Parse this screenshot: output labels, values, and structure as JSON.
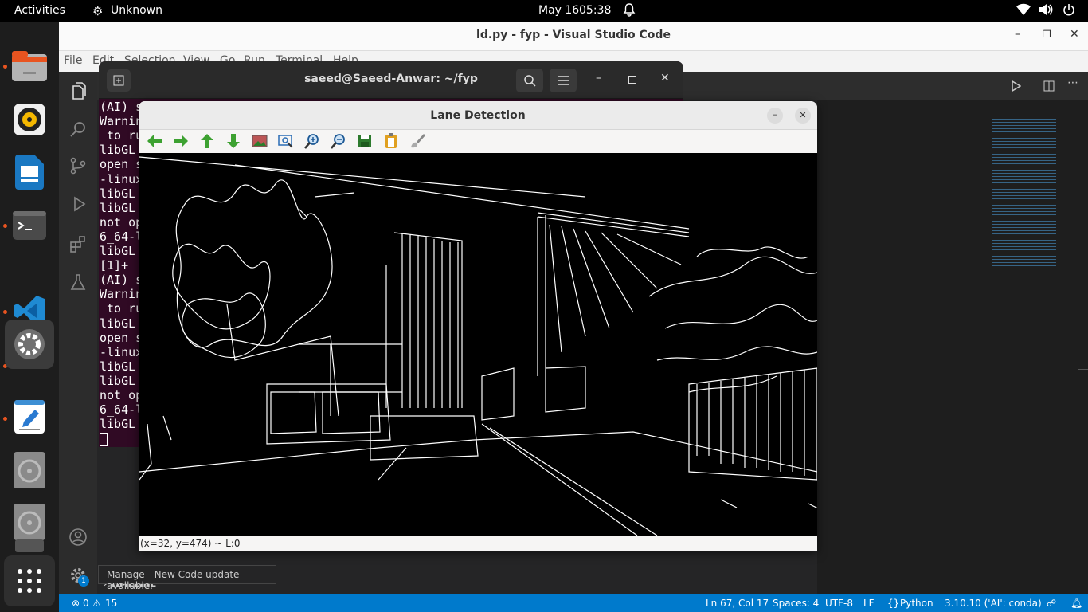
{
  "topbar": {
    "activities": "Activities",
    "app_name": "Unknown",
    "date": "May 16",
    "time": "05:38"
  },
  "vscode": {
    "title": "ld.py - fyp - Visual Studio Code",
    "menu": [
      "File",
      "Edit",
      "Selection",
      "View",
      "Go",
      "Run",
      "Terminal",
      "Help"
    ],
    "timeline": "TIMELINE",
    "tooltip": "Manage - New Code update available.",
    "manage_badge": "1",
    "status": {
      "errors": "0",
      "warnings": "15",
      "position": "Ln 67, Col 17",
      "spaces": "Spaces: 4",
      "encoding": "UTF-8",
      "eol": "LF",
      "language": "Python",
      "interpreter": "3.10.10 ('AI': conda)"
    }
  },
  "terminal": {
    "title": "saeed@Saeed-Anwar: ~/fyp",
    "lines": [
      "(AI) s",
      "Warnin",
      " to ru",
      "libGL ",
      "open s",
      "-linux",
      "libGL ",
      "libGL ",
      "not op",
      "6_64-l",
      "libGL ",
      "[1]+ ",
      "(AI) s",
      "Warnin",
      " to ru",
      "libGL ",
      "open s",
      "-linux",
      "libGL ",
      "libGL ",
      "not op",
      "6_64-l",
      "libGL "
    ]
  },
  "lane_window": {
    "title": "Lane Detection",
    "status": "(x=32, y=474) ~ L:0"
  },
  "colors": {
    "accent": "#e95420",
    "vscode_blue": "#007acc",
    "terminal_bg": "#300a24",
    "toolbar_green": "#3da131"
  },
  "icons": [
    "arrow-left-icon",
    "arrow-right-icon",
    "arrow-up-icon",
    "arrow-down-icon",
    "image-icon",
    "zoom-fit-icon",
    "zoom-in-icon",
    "zoom-out-icon",
    "save-icon",
    "copy-icon",
    "properties-icon"
  ]
}
